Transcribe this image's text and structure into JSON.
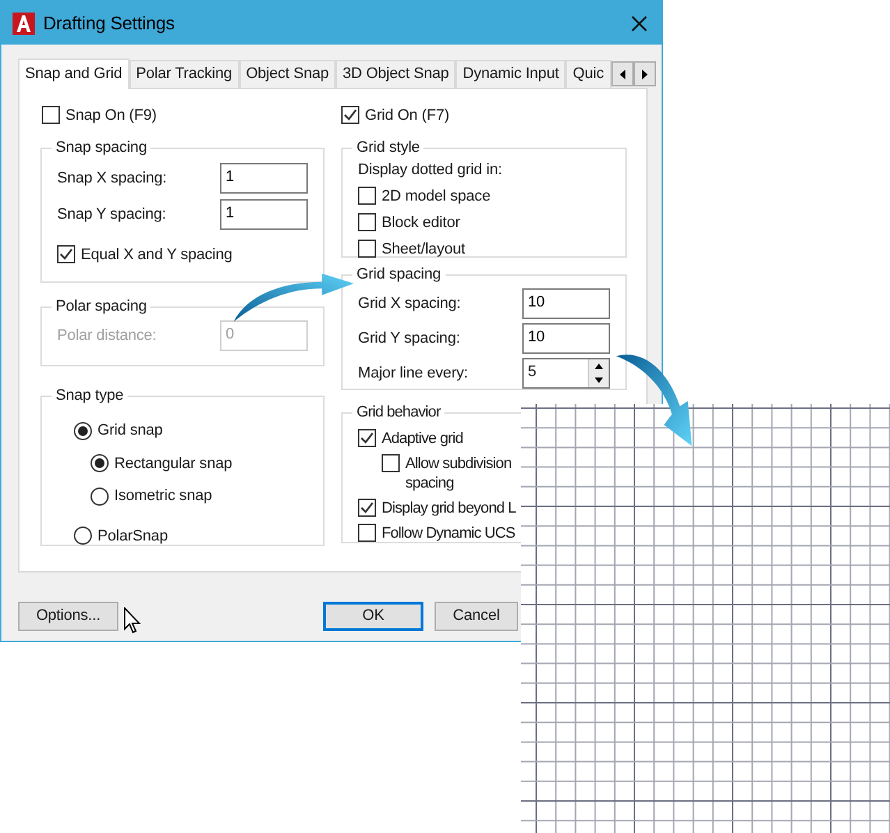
{
  "window": {
    "title": "Drafting Settings"
  },
  "tabs": [
    {
      "label": "Snap and Grid",
      "selected": true
    },
    {
      "label": "Polar Tracking",
      "selected": false
    },
    {
      "label": "Object Snap",
      "selected": false
    },
    {
      "label": "3D Object Snap",
      "selected": false
    },
    {
      "label": "Dynamic Input",
      "selected": false
    },
    {
      "label": "Quic",
      "selected": false
    }
  ],
  "snap_on": {
    "label": "Snap On (F9)",
    "checked": false
  },
  "snap_spacing": {
    "title": "Snap spacing",
    "fields": [
      {
        "label": "Snap X spacing:",
        "value": "1"
      },
      {
        "label": "Snap Y spacing:",
        "value": "1"
      }
    ],
    "equal": {
      "label": "Equal X and Y spacing",
      "checked": true
    }
  },
  "polar_spacing": {
    "title": "Polar spacing",
    "field": {
      "label": "Polar distance:",
      "value": "0",
      "disabled": true
    }
  },
  "snap_type": {
    "title": "Snap type",
    "options": [
      {
        "label": "Grid snap",
        "selected": true,
        "children": [
          {
            "label": "Rectangular snap",
            "selected": true
          },
          {
            "label": "Isometric snap",
            "selected": false
          }
        ]
      },
      {
        "label": "PolarSnap",
        "selected": false
      }
    ]
  },
  "grid_on": {
    "label": "Grid On (F7)",
    "checked": true
  },
  "grid_style": {
    "title": "Grid style",
    "caption": "Display dotted grid in:",
    "options": [
      {
        "label": "2D model space",
        "checked": false
      },
      {
        "label": "Block editor",
        "checked": false
      },
      {
        "label": "Sheet/layout",
        "checked": false
      }
    ]
  },
  "grid_spacing": {
    "title": "Grid spacing",
    "fields": [
      {
        "label": "Grid X spacing:",
        "value": "10",
        "kind": "text"
      },
      {
        "label": "Grid Y spacing:",
        "value": "10",
        "kind": "text"
      },
      {
        "label": "Major line every:",
        "value": "5",
        "kind": "spinner"
      }
    ]
  },
  "grid_behavior": {
    "title": "Grid behavior",
    "options": [
      {
        "label": [
          "Adaptive grid"
        ],
        "checked": true,
        "children": [
          {
            "label": [
              "Allow subdivision",
              "spacing"
            ],
            "checked": false
          }
        ]
      },
      {
        "label": [
          "Display grid beyond L"
        ],
        "checked": true
      },
      {
        "label": [
          "Follow Dynamic UCS"
        ],
        "checked": false
      }
    ]
  },
  "buttons": [
    {
      "label": "Options...",
      "default": false
    },
    {
      "label": "OK",
      "default": true
    },
    {
      "label": "Cancel",
      "default": false
    }
  ]
}
